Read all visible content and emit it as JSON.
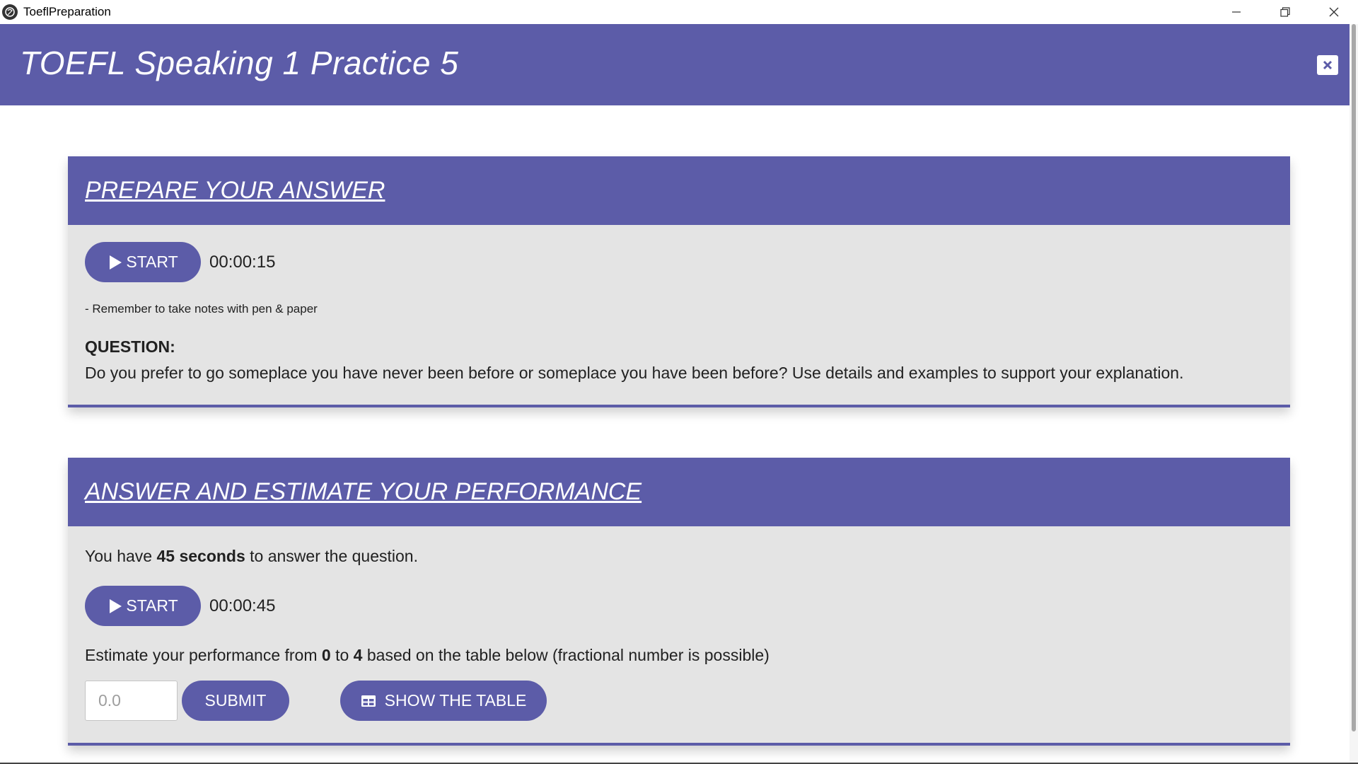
{
  "window": {
    "app_title": "ToeflPreparation",
    "icons": [
      "app-logo-icon",
      "minimize-icon",
      "restore-icon",
      "close-icon"
    ]
  },
  "appbar": {
    "title": "TOEFL Speaking 1 Practice 5",
    "close_icon": "close-box-icon",
    "color": "#5c5ca8"
  },
  "prepare": {
    "title": "PREPARE YOUR ANSWER",
    "start_label": "START",
    "timer": "00:00:15",
    "note": "- Remember to take notes with pen & paper",
    "question_label": "QUESTION:",
    "question_text": "Do you prefer to go someplace you have never been before or someplace you have been before? Use details and examples to support your explanation."
  },
  "answer": {
    "title": "ANSWER AND ESTIMATE YOUR PERFORMANCE",
    "time_prefix": "You have ",
    "time_bold": "45 seconds",
    "time_suffix": " to answer the question.",
    "start_label": "START",
    "timer": "00:00:45",
    "estimate_prefix": "Estimate your performance from ",
    "estimate_min": "0",
    "estimate_mid": " to ",
    "estimate_max": "4",
    "estimate_suffix": " based on the table below (fractional number is possible)",
    "score_placeholder": "0.0",
    "submit_label": "SUBMIT",
    "table_label": "SHOW THE TABLE"
  },
  "colors": {
    "accent": "#5c5ca8",
    "card_bg": "#e4e4e4"
  }
}
